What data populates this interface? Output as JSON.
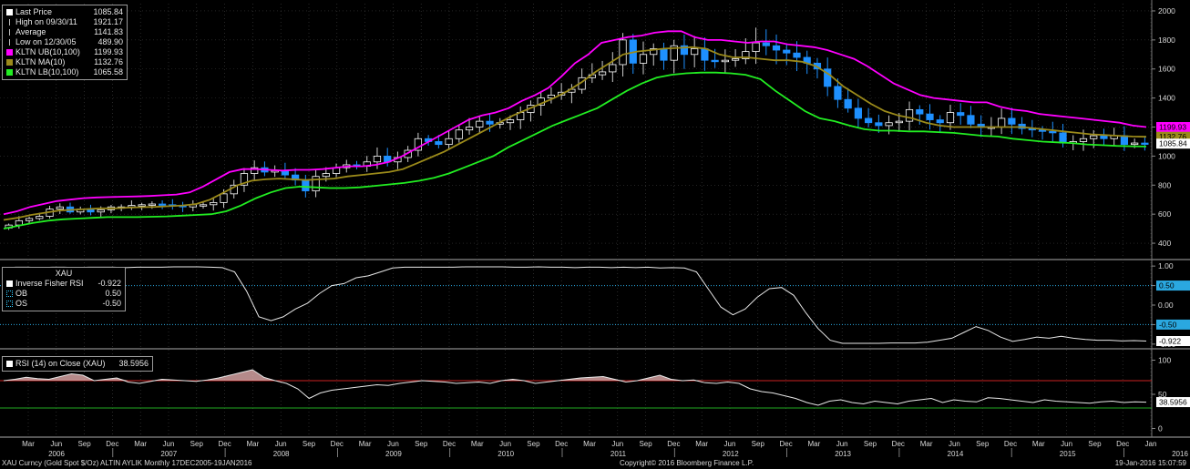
{
  "chart_data": [
    {
      "type": "candlestick",
      "panel": "price",
      "ylim": [
        300,
        2050
      ],
      "yticks": [
        400,
        600,
        800,
        1000,
        1200,
        1400,
        1600,
        1800,
        2000
      ],
      "legend": [
        {
          "label": "Last Price",
          "value": "1085.84",
          "color": "#ffffff",
          "icon": "square"
        },
        {
          "label": "High on 09/30/11",
          "value": "1921.17",
          "color": "#bbbbbb",
          "icon": "high-marker"
        },
        {
          "label": "Average",
          "value": "1141.83",
          "color": "#bbbbbb",
          "icon": "average-marker"
        },
        {
          "label": "Low on 12/30/05",
          "value": "489.90",
          "color": "#bbbbbb",
          "icon": "low-marker"
        },
        {
          "label": "KLTN UB(10,100)",
          "value": "1199.93",
          "color": "#ff00ff",
          "icon": "square"
        },
        {
          "label": "KLTN MA(10)",
          "value": "1132.76",
          "color": "#9b8a1a",
          "icon": "square"
        },
        {
          "label": "KLTN LB(10,100)",
          "value": "1065.58",
          "color": "#22ee22",
          "icon": "square"
        }
      ],
      "value_tags": [
        {
          "text": "1199.93",
          "value": 1199.93,
          "bg": "#ff00ff",
          "fg": "#000000"
        },
        {
          "text": "1132.76",
          "value": 1132.76,
          "bg": "#9b8a1a",
          "fg": "#000000"
        },
        {
          "text": "1085.84",
          "value": 1085.84,
          "bg": "#ffffff",
          "fg": "#000000"
        }
      ],
      "series": [
        {
          "name": "KLTN UB(10,100)",
          "color": "#ff00ff"
        },
        {
          "name": "KLTN MA(10)",
          "color": "#9b8a1a"
        },
        {
          "name": "KLTN LB(10,100)",
          "color": "#22ee22"
        }
      ],
      "closes": [
        525,
        555,
        570,
        585,
        635,
        650,
        615,
        635,
        615,
        630,
        650,
        650,
        660,
        665,
        670,
        665,
        660,
        650,
        665,
        665,
        680,
        740,
        800,
        880,
        920,
        890,
        900,
        870,
        835,
        760,
        860,
        880,
        920,
        940,
        930,
        960,
        1000,
        960,
        990,
        1040,
        1120,
        1100,
        1080,
        1120,
        1180,
        1200,
        1240,
        1220,
        1230,
        1250,
        1300,
        1350,
        1400,
        1420,
        1440,
        1460,
        1540,
        1560,
        1580,
        1630,
        1800,
        1640,
        1700,
        1740,
        1660,
        1760,
        1700,
        1740,
        1660,
        1650,
        1660,
        1670,
        1720,
        1780,
        1760,
        1730,
        1710,
        1680,
        1640,
        1600,
        1480,
        1390,
        1330,
        1260,
        1230,
        1210,
        1230,
        1240,
        1320,
        1290,
        1250,
        1230,
        1300,
        1280,
        1220,
        1200,
        1200,
        1260,
        1220,
        1190,
        1180,
        1170,
        1160,
        1090,
        1100,
        1120,
        1140,
        1120,
        1140,
        1080,
        1090,
        1085.84
      ],
      "ub": [
        600,
        620,
        650,
        670,
        690,
        700,
        710,
        715,
        718,
        720,
        722,
        725,
        730,
        735,
        750,
        790,
        840,
        890,
        910,
        910,
        905,
        900,
        905,
        905,
        910,
        920,
        930,
        930,
        940,
        960,
        1000,
        1050,
        1100,
        1150,
        1200,
        1250,
        1280,
        1300,
        1330,
        1380,
        1420,
        1470,
        1550,
        1640,
        1700,
        1780,
        1800,
        1820,
        1830,
        1850,
        1860,
        1860,
        1820,
        1800,
        1800,
        1790,
        1780,
        1790,
        1790,
        1770,
        1760,
        1750,
        1730,
        1700,
        1670,
        1620,
        1560,
        1500,
        1460,
        1420,
        1400,
        1390,
        1380,
        1370,
        1370,
        1340,
        1320,
        1310,
        1290,
        1280,
        1270,
        1260,
        1250,
        1240,
        1230,
        1210,
        1199.93
      ],
      "ma": [
        560,
        575,
        595,
        610,
        625,
        630,
        635,
        640,
        640,
        645,
        648,
        650,
        655,
        660,
        670,
        700,
        750,
        800,
        830,
        840,
        845,
        840,
        835,
        840,
        845,
        860,
        870,
        880,
        890,
        910,
        950,
        990,
        1030,
        1080,
        1130,
        1180,
        1230,
        1280,
        1320,
        1360,
        1400,
        1450,
        1510,
        1580,
        1640,
        1700,
        1720,
        1730,
        1740,
        1745,
        1750,
        1740,
        1700,
        1680,
        1680,
        1670,
        1660,
        1660,
        1650,
        1620,
        1560,
        1480,
        1420,
        1360,
        1310,
        1280,
        1260,
        1230,
        1210,
        1200,
        1200,
        1200,
        1200,
        1200,
        1200,
        1190,
        1180,
        1170,
        1160,
        1150,
        1145,
        1140,
        1135,
        1132.76
      ],
      "lb": [
        500,
        520,
        540,
        555,
        565,
        570,
        575,
        580,
        580,
        580,
        582,
        585,
        590,
        595,
        600,
        620,
        660,
        710,
        750,
        780,
        790,
        785,
        780,
        780,
        785,
        795,
        805,
        815,
        830,
        850,
        880,
        920,
        960,
        1000,
        1060,
        1110,
        1160,
        1210,
        1250,
        1290,
        1330,
        1390,
        1450,
        1500,
        1540,
        1560,
        1570,
        1575,
        1575,
        1570,
        1560,
        1530,
        1450,
        1380,
        1310,
        1260,
        1240,
        1210,
        1185,
        1175,
        1175,
        1170,
        1170,
        1165,
        1160,
        1150,
        1140,
        1135,
        1120,
        1110,
        1100,
        1095,
        1090,
        1080,
        1075,
        1070,
        1068,
        1065.58
      ],
      "annotations": {
        "high": "1921.17",
        "low": "489.90"
      }
    },
    {
      "type": "line",
      "panel": "inverse-fisher-rsi",
      "title": "XAU",
      "ylim": [
        -1.05,
        1.05
      ],
      "yticks": [
        {
          "label": "1.00",
          "value": 1.0
        },
        {
          "label": "0.50",
          "value": 0.5
        },
        {
          "label": "0.00",
          "value": 0.0
        },
        {
          "label": "-0.50",
          "value": -0.5
        },
        {
          "label": "-1.00",
          "value": -1.0
        }
      ],
      "legend": [
        {
          "label": "Inverse Fisher RSI",
          "value": "-0.922",
          "color": "#ffffff",
          "icon": "square"
        },
        {
          "label": "OB",
          "value": "0.50",
          "color": "#33ccff",
          "icon": "dotted-box"
        },
        {
          "label": "OS",
          "value": "-0.50",
          "color": "#33ccff",
          "icon": "dotted-box"
        }
      ],
      "value_tags": [
        {
          "text": "0.50",
          "value": 0.5,
          "bg": "#2aa8e0",
          "fg": "#000000"
        },
        {
          "text": "-0.50",
          "value": -0.5,
          "bg": "#2aa8e0",
          "fg": "#000000"
        },
        {
          "text": "-0.922",
          "value": -0.922,
          "bg": "#ffffff",
          "fg": "#000000"
        }
      ],
      "levels": [
        0.5,
        -0.5
      ],
      "series": [
        {
          "name": "Inverse Fisher RSI",
          "color": "#e8e8e8",
          "values": [
            0.95,
            0.97,
            0.97,
            0.96,
            0.97,
            0.97,
            0.96,
            0.97,
            0.97,
            0.97,
            0.96,
            0.97,
            0.97,
            0.97,
            0.98,
            0.98,
            0.98,
            0.97,
            0.96,
            0.85,
            0.35,
            -0.3,
            -0.4,
            -0.3,
            -0.1,
            0.05,
            0.3,
            0.5,
            0.55,
            0.7,
            0.75,
            0.85,
            0.95,
            0.97,
            0.97,
            0.97,
            0.97,
            0.97,
            0.98,
            0.98,
            0.98,
            0.98,
            0.97,
            0.97,
            0.98,
            0.97,
            0.97,
            0.96,
            0.97,
            0.97,
            0.96,
            0.97,
            0.96,
            0.97,
            0.95,
            0.96,
            0.95,
            0.85,
            0.4,
            -0.05,
            -0.25,
            -0.1,
            0.2,
            0.42,
            0.45,
            0.25,
            -0.2,
            -0.6,
            -0.9,
            -0.98,
            -0.98,
            -0.98,
            -0.98,
            -0.97,
            -0.97,
            -0.97,
            -0.95,
            -0.9,
            -0.85,
            -0.7,
            -0.55,
            -0.65,
            -0.82,
            -0.93,
            -0.88,
            -0.82,
            -0.85,
            -0.8,
            -0.85,
            -0.88,
            -0.9,
            -0.9,
            -0.92,
            -0.91,
            -0.922
          ]
        }
      ]
    },
    {
      "type": "area",
      "panel": "rsi",
      "ylim": [
        -10,
        110
      ],
      "yticks": [
        {
          "label": "100",
          "value": 100
        },
        {
          "label": "50",
          "value": 50
        },
        {
          "label": "0",
          "value": 0
        }
      ],
      "legend": [
        {
          "label": "RSI (14) on Close (XAU)",
          "value": "38.5956",
          "color": "#ffffff",
          "icon": "square"
        }
      ],
      "value_tags": [
        {
          "text": "38.5956",
          "value": 38.5956,
          "bg": "#ffffff",
          "fg": "#000000"
        }
      ],
      "levels": [
        {
          "value": 70,
          "color": "#cc2222"
        },
        {
          "value": 30,
          "color": "#22aa22"
        }
      ],
      "series": [
        {
          "name": "RSI (14) on Close (XAU)",
          "color": "#e8e8e8",
          "fill_above": 70,
          "fill_color": "#f2b8b8",
          "values": [
            70,
            72,
            75,
            73,
            72,
            76,
            80,
            78,
            70,
            72,
            74,
            68,
            66,
            69,
            72,
            71,
            70,
            69,
            71,
            74,
            78,
            82,
            86,
            75,
            70,
            66,
            58,
            44,
            52,
            56,
            58,
            60,
            62,
            64,
            63,
            66,
            68,
            70,
            69,
            68,
            66,
            67,
            68,
            66,
            70,
            72,
            70,
            66,
            68,
            70,
            72,
            74,
            75,
            76,
            72,
            68,
            70,
            74,
            78,
            72,
            70,
            71,
            67,
            66,
            68,
            66,
            58,
            54,
            52,
            48,
            44,
            38,
            34,
            40,
            42,
            38,
            36,
            40,
            38,
            36,
            40,
            42,
            44,
            38,
            42,
            40,
            39,
            45,
            44,
            42,
            40,
            38,
            42,
            40,
            39,
            38,
            37,
            39,
            40,
            38,
            39,
            38.5956
          ]
        }
      ]
    }
  ],
  "x_axis": {
    "months": [
      "Mar",
      "Jun",
      "Sep",
      "Dec",
      "Mar",
      "Jun",
      "Sep",
      "Dec",
      "Mar",
      "Jun",
      "Sep",
      "Dec",
      "Mar",
      "Jun",
      "Sep",
      "Dec",
      "Mar",
      "Jun",
      "Sep",
      "Dec",
      "Mar",
      "Jun",
      "Sep",
      "Dec",
      "Mar",
      "Jun",
      "Sep",
      "Dec",
      "Mar",
      "Jun",
      "Sep",
      "Dec",
      "Mar",
      "Jun",
      "Sep",
      "Dec",
      "Mar",
      "Jun",
      "Sep",
      "Dec",
      "Jan"
    ],
    "years": [
      "2006",
      "2007",
      "2008",
      "2009",
      "2010",
      "2011",
      "2012",
      "2013",
      "2014",
      "2015",
      "2016"
    ]
  },
  "footer": {
    "left": "XAU Curncy (Gold Spot   $/Oz) ALTIN AYLIK  Monthly 17DEC2005-19JAN2016",
    "center": "Copyright© 2016 Bloomberg Finance L.P.",
    "right": "19-Jan-2016 15:07:59"
  }
}
